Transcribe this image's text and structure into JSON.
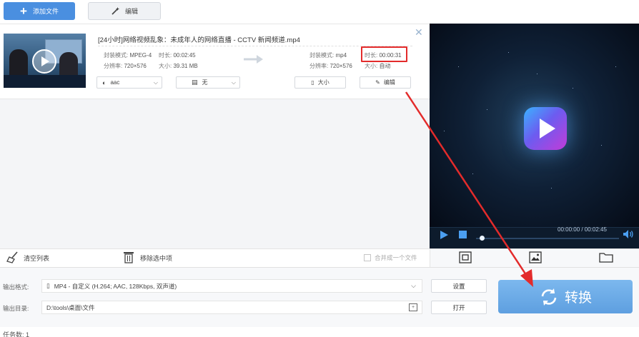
{
  "toolbar": {
    "add_file_label": "添加文件",
    "edit_label": "编辑"
  },
  "file": {
    "title": "[24小时]网络视频乱象：未成年人的网络直播 - CCTV 新闻频道.mp4",
    "source": {
      "format_label": "封装模式:",
      "format_value": "MPEG-4",
      "duration_label": "时长:",
      "duration_value": "00:02:45",
      "resolution_label": "分辨率:",
      "resolution_value": "720×576",
      "size_label": "大小:",
      "size_value": "39.31 MB"
    },
    "target": {
      "format_label": "封装模式:",
      "format_value": "mp4",
      "duration_label": "时长:",
      "duration_value": "00:00:31",
      "resolution_label": "分辨率:",
      "resolution_value": "720×576",
      "size_label": "大小:",
      "size_value": "自动"
    },
    "audio_select": "aac",
    "subtitle_select": "无",
    "size_button": "大小",
    "edit_button": "编辑"
  },
  "player": {
    "time": "00:00:00 / 00:02:45",
    "progress_fraction": 0.03
  },
  "list_tools": {
    "clear_label": "清空列表",
    "remove_label": "移除选中项",
    "merge_label": "合并成一个文件"
  },
  "output": {
    "format_label": "输出格式:",
    "format_value": "MP4 - 自定义 (H.264; AAC, 128Kbps, 双声道)",
    "dir_label": "输出目录:",
    "dir_value": "D:\\tools\\桌面\\文件",
    "settings_button": "设置",
    "open_button": "打开",
    "convert_button": "转换"
  },
  "status": {
    "task_count": "任务数: 1"
  },
  "colors": {
    "accent": "#4a8fe0",
    "convert": "#6aa9e6",
    "annotation": "#e32b2b"
  }
}
